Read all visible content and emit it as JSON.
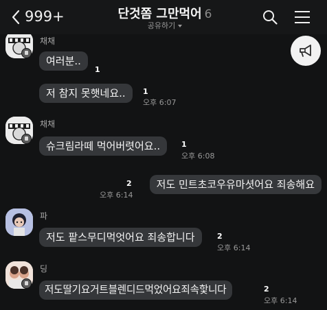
{
  "header": {
    "back_count": "999+",
    "title": "단것쫌 그만먹어",
    "member_count": "6",
    "share_label": "공유하기"
  },
  "messages": [
    {
      "sender": "채채",
      "text": "여러분..",
      "unread": "1",
      "time": ""
    },
    {
      "sender": "",
      "text": "저 참지 못햇네요..",
      "unread": "1",
      "time": "오후 6:07"
    },
    {
      "sender": "채채",
      "text": "슈크림라떼 먹어버렷어요..",
      "unread": "1",
      "time": "오후 6:08"
    },
    {
      "sender": "",
      "text": "저도 민트초코우유마셧어요 죄송해요",
      "unread": "2",
      "time": "오후 6:14"
    },
    {
      "sender": "파",
      "text": "저도 팥스무디먹엇어요 죄송합니다",
      "unread": "2",
      "time": "오후 6:14"
    },
    {
      "sender": "딩",
      "text": "저도딸기요거트블렌디드먹었어요죄속핯니다",
      "unread": "2",
      "time": "오후 6:14"
    }
  ],
  "colors": {
    "background": "#121314",
    "bubble": "#35373a",
    "text": "#f4f4f4",
    "meta_text": "#9a9a9a"
  },
  "icons": [
    "back-arrow-icon",
    "search-icon",
    "menu-icon",
    "megaphone-icon",
    "avatar-badge-icon"
  ]
}
